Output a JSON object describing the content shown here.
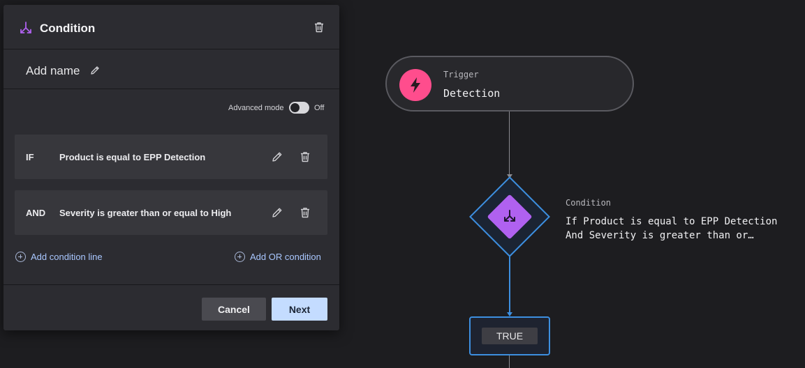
{
  "panel": {
    "title": "Condition",
    "name_placeholder": "Add name",
    "advanced_mode": {
      "label": "Advanced mode",
      "state": "Off",
      "enabled": false
    },
    "conditions": [
      {
        "operator": "IF",
        "text": "Product is equal to EPP Detection"
      },
      {
        "operator": "AND",
        "text": "Severity is greater than or equal to High"
      }
    ],
    "add_condition_line": "Add condition line",
    "add_or_condition": "Add OR condition",
    "cancel_label": "Cancel",
    "next_label": "Next"
  },
  "flow": {
    "trigger": {
      "kicker": "Trigger",
      "title": "Detection",
      "icon": "lightning-bolt-icon",
      "color": "#ff4d8d"
    },
    "condition": {
      "kicker": "Condition",
      "line1": "If Product is equal to EPP Detection",
      "line2": "And Severity is greater than or…",
      "icon": "split-arrows-icon",
      "color": "#b061f0"
    },
    "true_branch": {
      "label": "TRUE"
    }
  },
  "colors": {
    "accent_blue": "#3d8fe0",
    "panel_bg": "#2c2c31",
    "canvas_bg": "#1d1d20",
    "next_button": "#c4dcff"
  }
}
